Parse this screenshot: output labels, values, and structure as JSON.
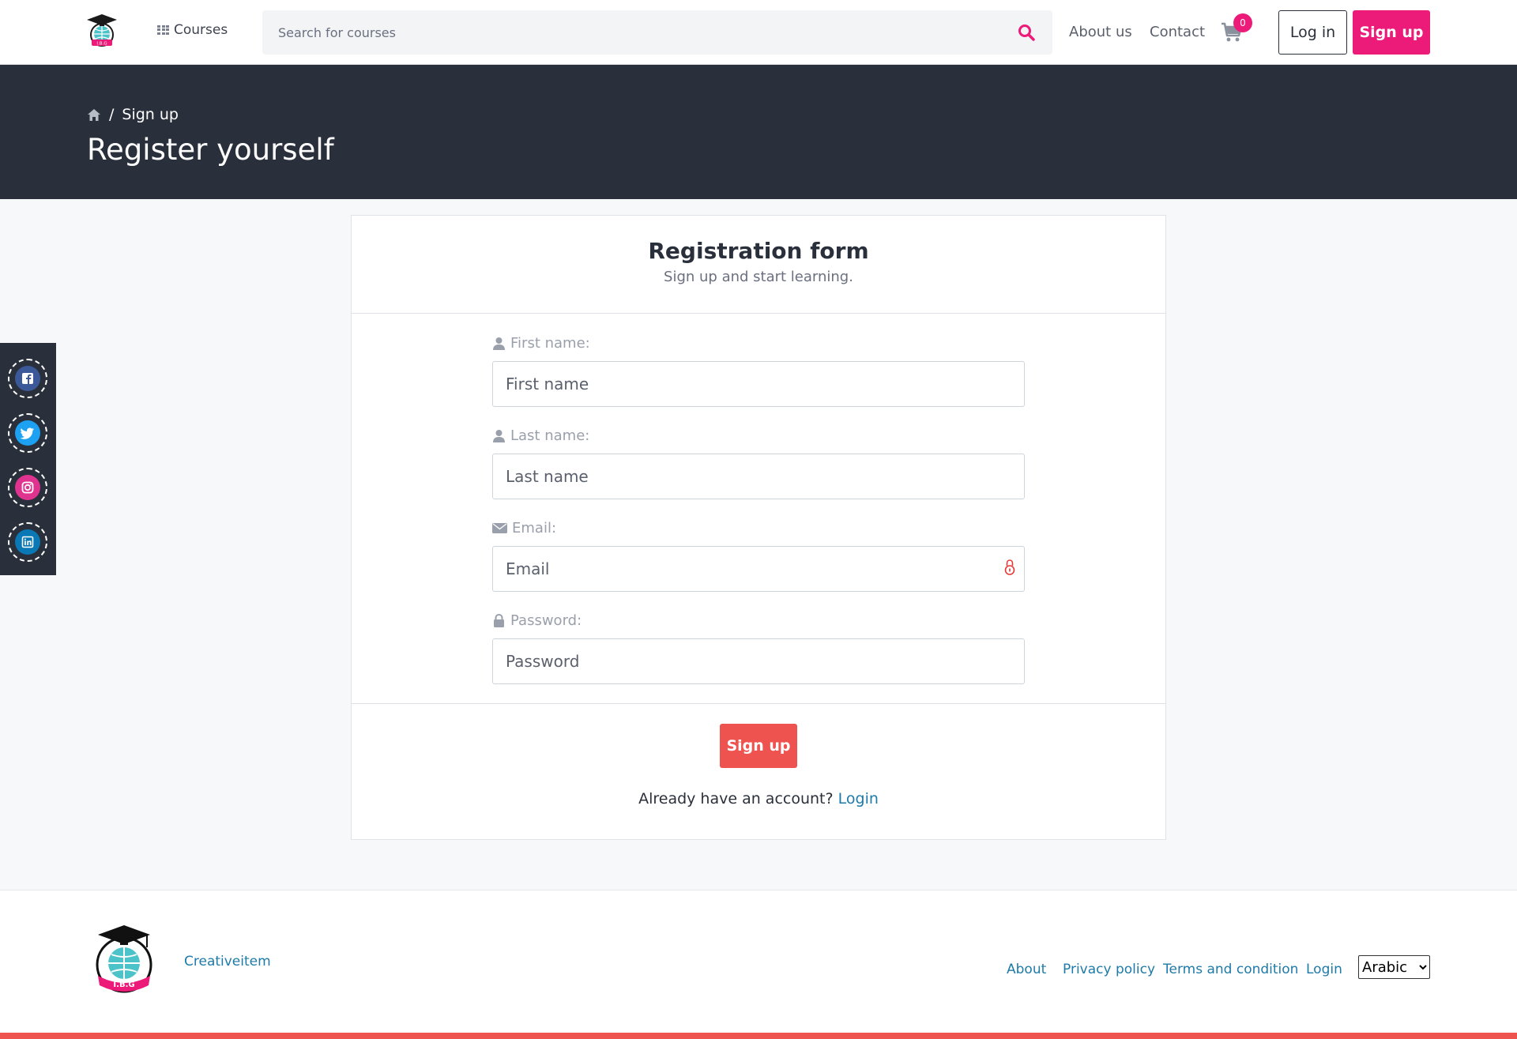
{
  "header": {
    "logo_text": "I.B.G",
    "courses_label": "Courses",
    "search_placeholder": "Search for courses",
    "about_label": "About us",
    "contact_label": "Contact",
    "cart_count": "0",
    "login_label": "Log in",
    "signup_label": "Sign up"
  },
  "banner": {
    "breadcrumb_sep": "/",
    "breadcrumb_current": "Sign up",
    "title": "Register yourself"
  },
  "social": [
    "facebook-icon",
    "twitter-icon",
    "instagram-icon",
    "linkedin-icon"
  ],
  "form": {
    "title": "Registration form",
    "subtitle": "Sign up and start learning.",
    "first_name_label": "First name:",
    "first_name_placeholder": "First name",
    "last_name_label": "Last name:",
    "last_name_placeholder": "Last name",
    "email_label": "Email:",
    "email_placeholder": "Email",
    "password_label": "Password:",
    "password_placeholder": "Password",
    "submit_label": "Sign up",
    "already_text": "Already have an account?",
    "login_link": "Login"
  },
  "footer": {
    "logo_text": "I.B.G",
    "creativeitem": "Creativeitem",
    "links": [
      "About",
      "Privacy policy",
      "Terms and condition",
      "Login"
    ],
    "language_selected": "Arabic"
  },
  "colors": {
    "brand_pink": "#ec1a78",
    "dark_banner": "#2a303b",
    "submit_red": "#ef5350",
    "link_blue": "#1e7aa8"
  }
}
